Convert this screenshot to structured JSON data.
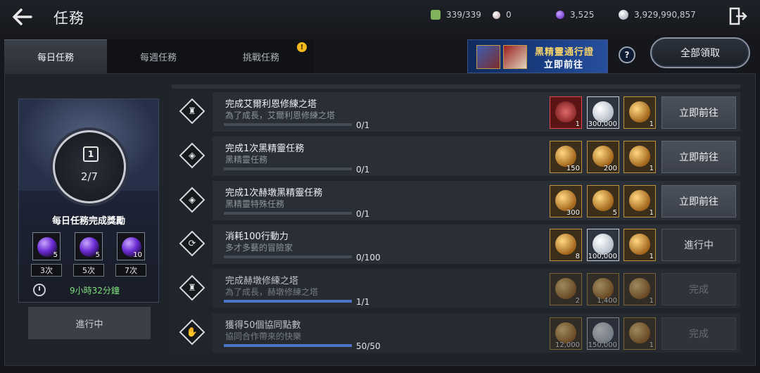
{
  "header": {
    "title": "任務",
    "resources": [
      {
        "icon": "green-energy-icon",
        "color": "#7fb25a",
        "value": "339/339"
      },
      {
        "icon": "pearl-icon",
        "color": "#d9c6c6",
        "value": "0"
      },
      {
        "icon": "purple-orb-icon",
        "color": "#7b3fd6",
        "value": "3,525"
      },
      {
        "icon": "silver-coin-icon",
        "color": "#b9c3d1",
        "value": "3,929,990,857"
      }
    ]
  },
  "tabs": [
    {
      "label": "每日任務",
      "active": true
    },
    {
      "label": "每週任務",
      "active": false
    },
    {
      "label": "挑戰任務",
      "active": false,
      "alert": "!"
    }
  ],
  "promo": {
    "line1": "黑精靈通行證",
    "line2": "立即前往"
  },
  "help_label": "?",
  "claim_all_label": "全部領取",
  "reward_card": {
    "badge": "1",
    "count": "2/7",
    "title": "每日任務完成獎勵",
    "tiers": [
      {
        "qty": "5",
        "times": "3次"
      },
      {
        "qty": "5",
        "times": "5次"
      },
      {
        "qty": "10",
        "times": "7次"
      }
    ],
    "timer": "9小時32分鐘",
    "status": "進行中"
  },
  "quests": [
    {
      "title": "完成艾爾利恩修練之塔",
      "subtitle": "為了成長，艾爾利恩修練之塔",
      "progress_text": "0/1",
      "progress": 0.0,
      "glyph": "♜",
      "rewards": [
        {
          "kind": "red",
          "qty": "1"
        },
        {
          "kind": "silver",
          "qty": "300,000"
        },
        {
          "kind": "gold",
          "qty": "1"
        }
      ],
      "action": "立即前往",
      "state": "go"
    },
    {
      "title": "完成1次黑精靈任務",
      "subtitle": "黑精靈任務",
      "progress_text": "0/1",
      "progress": 0.0,
      "glyph": "◈",
      "rewards": [
        {
          "kind": "gold",
          "qty": "150"
        },
        {
          "kind": "gold",
          "qty": "200"
        },
        {
          "kind": "gold",
          "qty": "1"
        }
      ],
      "action": "立即前往",
      "state": "go"
    },
    {
      "title": "完成1次赫墩黑精靈任務",
      "subtitle": "黑精靈特殊任務",
      "progress_text": "0/1",
      "progress": 0.0,
      "glyph": "◈",
      "rewards": [
        {
          "kind": "gold",
          "qty": "300"
        },
        {
          "kind": "gold",
          "qty": "5"
        },
        {
          "kind": "gold",
          "qty": "1"
        }
      ],
      "action": "立即前往",
      "state": "go"
    },
    {
      "title": "消耗100行動力",
      "subtitle": "多才多藝的冒險家",
      "progress_text": "0/100",
      "progress": 0.0,
      "glyph": "⟳",
      "rewards": [
        {
          "kind": "gold",
          "qty": "8"
        },
        {
          "kind": "silver",
          "qty": "100,000"
        },
        {
          "kind": "gold",
          "qty": "1"
        }
      ],
      "action": "進行中",
      "state": "prog"
    },
    {
      "title": "完成赫墩修練之塔",
      "subtitle": "為了成長，赫墩修練之塔",
      "progress_text": "1/1",
      "progress": 1.0,
      "glyph": "♜",
      "rewards": [
        {
          "kind": "gold",
          "qty": "2"
        },
        {
          "kind": "gold",
          "qty": "1,400"
        },
        {
          "kind": "gold",
          "qty": "1"
        }
      ],
      "action": "完成",
      "state": "fin"
    },
    {
      "title": "獲得50個協同點數",
      "subtitle": "協同合作帶來的快樂",
      "progress_text": "50/50",
      "progress": 1.0,
      "glyph": "✋",
      "rewards": [
        {
          "kind": "gold",
          "qty": "12,000"
        },
        {
          "kind": "silver",
          "qty": "150,000"
        },
        {
          "kind": "gold",
          "qty": "1"
        }
      ],
      "action": "完成",
      "state": "fin"
    }
  ]
}
